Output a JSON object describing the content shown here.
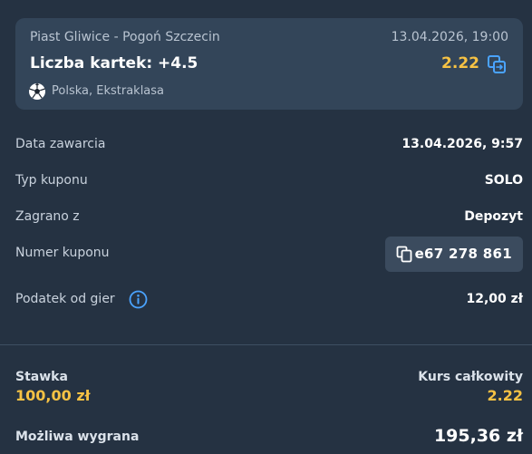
{
  "event": {
    "teams": "Piast Gliwice - Pogoń Szczecin",
    "datetime": "13.04.2026, 19:00",
    "market": "Liczba kartek: +4.5",
    "odds": "2.22",
    "league": "Polska, Ekstraklasa",
    "icons": {
      "sport": "soccer-ball-icon",
      "action": "swap-icon"
    }
  },
  "details": {
    "date_label": "Data zawarcia",
    "date_value": "13.04.2026, 9:57",
    "type_label": "Typ kuponu",
    "type_value": "SOLO",
    "source_label": "Zagrano z",
    "source_value": "Depozyt",
    "number_label": "Numer kuponu",
    "number_value": "e67 278 861",
    "tax_label": "Podatek od gier",
    "tax_value": "12,00 zł"
  },
  "summary": {
    "stake_label": "Stawka",
    "stake_value": "100,00 zł",
    "total_odds_label": "Kurs całkowity",
    "total_odds_value": "2.22",
    "win_label": "Możliwa wygrana",
    "win_value": "195,36 zł"
  },
  "colors": {
    "background": "#253242",
    "card": "#334559",
    "accent": "#f6c244",
    "link_blue": "#4aa3ff"
  }
}
